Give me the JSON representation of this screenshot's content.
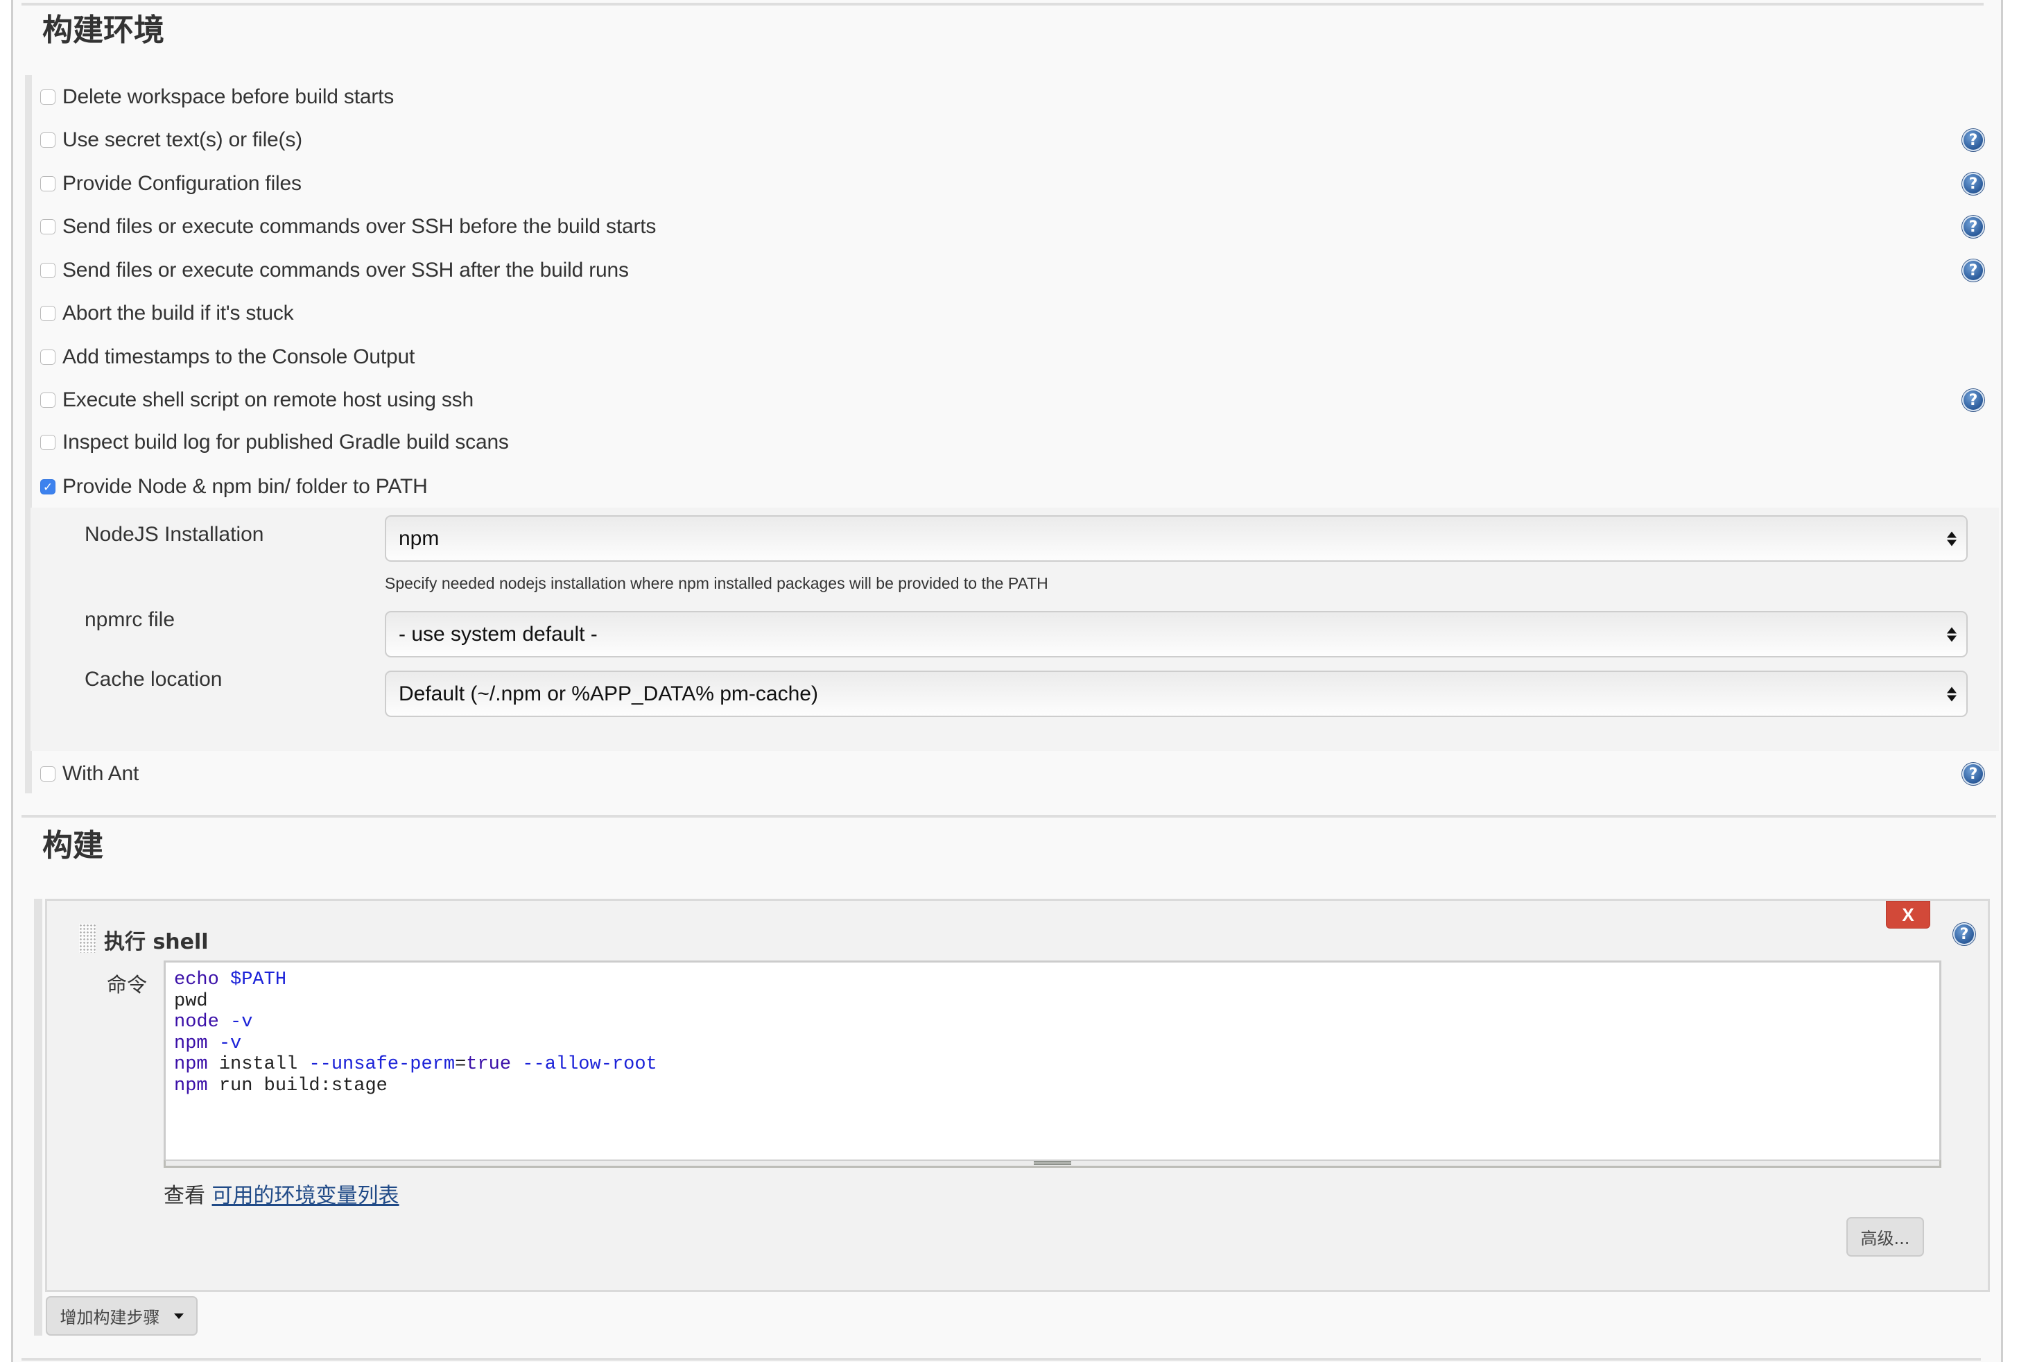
{
  "build_env": {
    "title": "构建环境",
    "options": [
      {
        "label": "Delete workspace before build starts",
        "checked": false,
        "help": false
      },
      {
        "label": "Use secret text(s) or file(s)",
        "checked": false,
        "help": true
      },
      {
        "label": "Provide Configuration files",
        "checked": false,
        "help": true
      },
      {
        "label": "Send files or execute commands over SSH before the build starts",
        "checked": false,
        "help": true
      },
      {
        "label": "Send files or execute commands over SSH after the build runs",
        "checked": false,
        "help": true
      },
      {
        "label": "Abort the build if it's stuck",
        "checked": false,
        "help": false
      },
      {
        "label": "Add timestamps to the Console Output",
        "checked": false,
        "help": false
      },
      {
        "label": "Execute shell script on remote host using ssh",
        "checked": false,
        "help": true
      },
      {
        "label": "Inspect build log for published Gradle build scans",
        "checked": false,
        "help": false
      },
      {
        "label": "Provide Node & npm bin/ folder to PATH",
        "checked": true,
        "help": false
      }
    ],
    "node_config": {
      "nodejs_installation": {
        "label": "NodeJS Installation",
        "value": "npm",
        "help_text": "Specify needed nodejs installation where npm installed packages will be provided to the PATH"
      },
      "npmrc_file": {
        "label": "npmrc file",
        "value": "- use system default -"
      },
      "cache_location": {
        "label": "Cache location",
        "value": "Default (~/.npm or %APP_DATA% pm-cache)"
      }
    },
    "with_ant": {
      "label": "With Ant",
      "checked": false,
      "help": true
    }
  },
  "build": {
    "title": "构建",
    "step": {
      "title": "执行 shell",
      "delete_label": "X",
      "command_label": "命令",
      "command_lines": [
        "echo $PATH",
        "pwd",
        "node -v",
        "npm -v",
        "npm install --unsafe-perm=true --allow-root",
        "npm run build:stage"
      ],
      "env_prefix": "查看",
      "env_link": "可用的环境变量列表",
      "advanced_label": "高级..."
    },
    "add_step_label": "增加构建步骤"
  },
  "icons": {
    "help": "?",
    "checkmark": "✓"
  },
  "colors": {
    "checkbox_checked": "#3d82ee",
    "delete_button": "#d24939",
    "link": "#204a87",
    "code_keyword": "#3a0fa8",
    "code_option": "#1b22d8"
  }
}
